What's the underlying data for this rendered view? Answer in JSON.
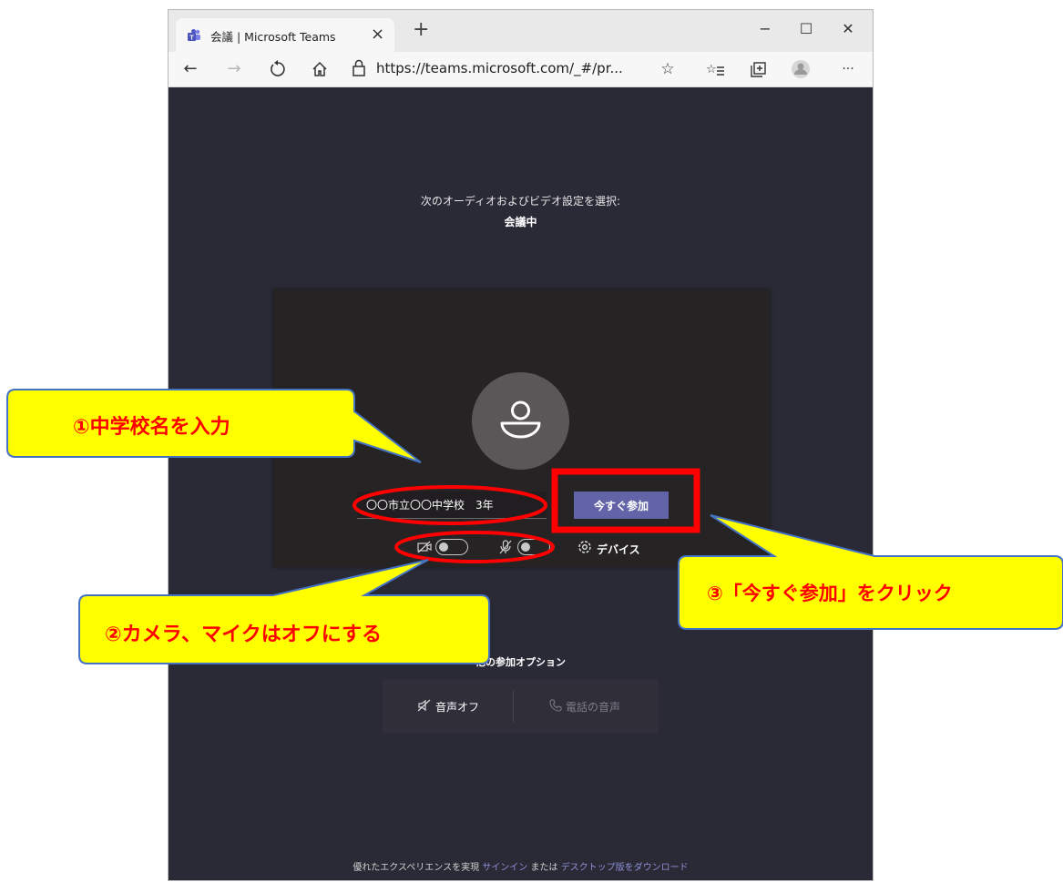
{
  "browser": {
    "tab_title": "会議 | Microsoft Teams",
    "tab_close": "×",
    "new_tab": "+",
    "window_controls": {
      "minimize": "−",
      "maximize": "☐",
      "close": "✕"
    },
    "url": "https://teams.microsoft.com/_#/pr...",
    "toolbar_icons": [
      "back-arrow-icon",
      "forward-arrow-icon",
      "refresh-icon",
      "home-icon",
      "lock-icon",
      "favorite-star-icon",
      "favorites-list-icon",
      "collections-icon",
      "profile-icon",
      "more-icon"
    ],
    "more_label": "···"
  },
  "prejoin": {
    "prompt": "次のオーディオおよびビデオ設定を選択:",
    "meeting_name": "会議中",
    "name_input_value": "〇〇市立〇〇中学校　3年",
    "join_button": "今すぐ参加",
    "devices_label": "デバイス",
    "camera_on": false,
    "mic_on": false
  },
  "other_options": {
    "title": "他の参加オプション",
    "audio_off": "音声オフ",
    "phone_audio": "電話の音声"
  },
  "footer": {
    "text": "優れたエクスペリエンスを実現",
    "sign_in": "サインイン",
    "or": "または",
    "download": "デスクトップ版をダウンロード"
  },
  "annotations": {
    "callout1": "①中学校名を入力",
    "callout2": "②カメラ、マイクはオフにする",
    "callout3": "③「今すぐ参加」をクリック"
  },
  "colors": {
    "page_bg": "#292a36",
    "join_button": "#6264a7",
    "callout_fill": "#ffff00",
    "callout_border": "#4472c4",
    "annotation_red": "#ff0000"
  }
}
